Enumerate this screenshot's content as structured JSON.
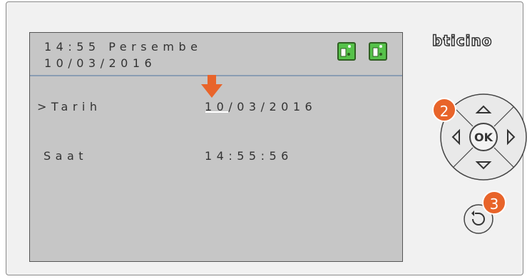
{
  "header": {
    "time_day": "14:55 Persembe",
    "date": "10/03/2016"
  },
  "rows": [
    {
      "label": ">Tarih",
      "value": "10/03/2016"
    },
    {
      "label": "Saat",
      "value": "14:55:56"
    }
  ],
  "brand": {
    "logo": "bticino"
  },
  "controls": {
    "ok_label": "OK",
    "step_dpad": "2",
    "step_back": "3"
  },
  "colors": {
    "screen": "#c6c6c6",
    "accent": "#e8642a",
    "icon_green": "#56c24a",
    "divider": "#8a9db3"
  },
  "icons": [
    "door-unlock-icon",
    "intercom-icon",
    "up-arrow-icon",
    "down-arrow-icon",
    "left-arrow-icon",
    "right-arrow-icon",
    "back-icon",
    "pointer-arrow-icon"
  ]
}
